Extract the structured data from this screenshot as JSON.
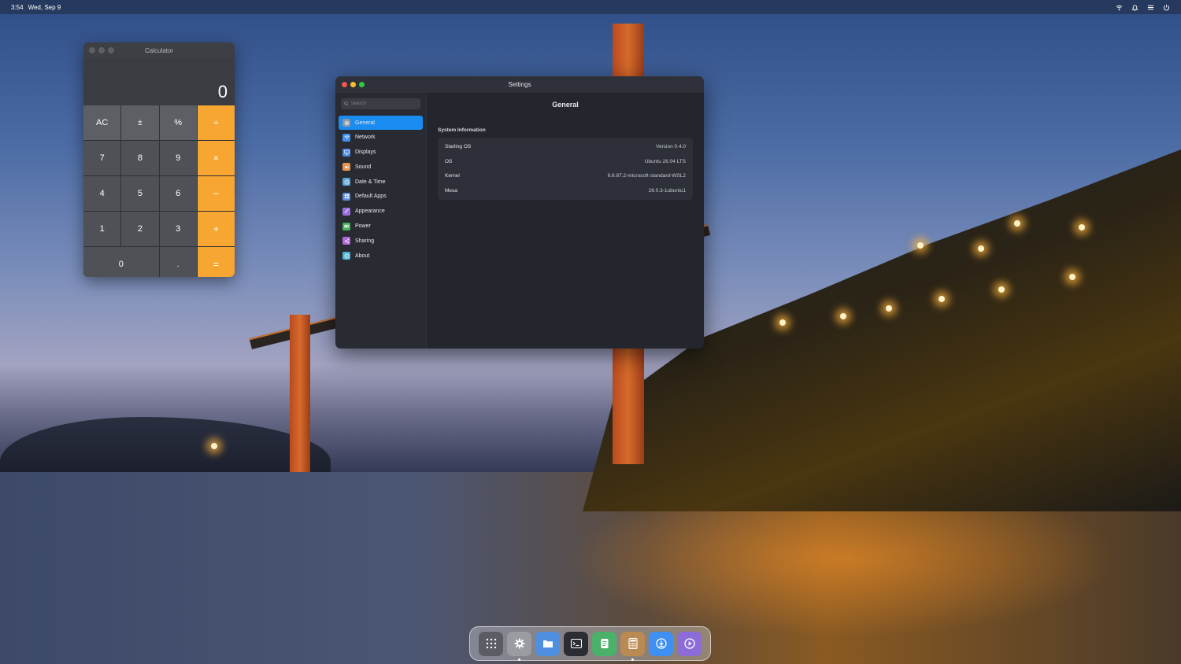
{
  "topbar": {
    "time": "3:54",
    "date": "Wed, Sep 9",
    "tray_icons": [
      "wifi-icon",
      "bell-icon",
      "menu-icon",
      "power-icon"
    ]
  },
  "calculator": {
    "title": "Calculator",
    "display": "0",
    "keys": [
      "AC",
      "±",
      "%",
      "÷",
      "7",
      "8",
      "9",
      "×",
      "4",
      "5",
      "6",
      "−",
      "1",
      "2",
      "3",
      "+",
      "0",
      ".",
      "="
    ],
    "colors": {
      "operator": "#f8a632",
      "function": "#5d5f64",
      "digit": "#4f5156"
    }
  },
  "settings": {
    "title": "Settings",
    "search_placeholder": "Search",
    "nav": [
      {
        "label": "General",
        "icon": "gear-icon",
        "color": "#8e95a3",
        "active": true
      },
      {
        "label": "Network",
        "icon": "wifi-icon",
        "color": "#3f8ef1"
      },
      {
        "label": "Displays",
        "icon": "display-icon",
        "color": "#4a87e5"
      },
      {
        "label": "Sound",
        "icon": "speaker-icon",
        "color": "#e8924a"
      },
      {
        "label": "Date & Time",
        "icon": "clock-icon",
        "color": "#5ba3d8"
      },
      {
        "label": "Default Apps",
        "icon": "grid-icon",
        "color": "#5d8be0"
      },
      {
        "label": "Appearance",
        "icon": "brush-icon",
        "color": "#9a6ee0"
      },
      {
        "label": "Power",
        "icon": "battery-icon",
        "color": "#45b35a"
      },
      {
        "label": "Sharing",
        "icon": "share-icon",
        "color": "#b069d9"
      },
      {
        "label": "About",
        "icon": "info-icon",
        "color": "#4cb4d4"
      }
    ],
    "page_title": "General",
    "section_label": "System Information",
    "info": [
      {
        "key": "Starling OS",
        "value": "Version 0.4.0"
      },
      {
        "key": "OS",
        "value": "Ubuntu 26.04 LTS"
      },
      {
        "key": "Kernel",
        "value": "6.6.87.2-microsoft-standard-WSL2"
      },
      {
        "key": "Mesa",
        "value": "26.0.3-1ubuntu1"
      }
    ],
    "accent": "#1a8cf2"
  },
  "dock": {
    "items": [
      {
        "name": "app-grid-icon",
        "color": "#5a5d64",
        "running": false
      },
      {
        "name": "settings-icon",
        "color": "#9a9ca2",
        "running": true
      },
      {
        "name": "files-icon",
        "color": "#4f8fe0",
        "running": false
      },
      {
        "name": "terminal-icon",
        "color": "#2b2d33",
        "running": false
      },
      {
        "name": "notes-icon",
        "color": "#4bb06a",
        "running": false
      },
      {
        "name": "calculator-icon",
        "color": "#b98a52",
        "running": true
      },
      {
        "name": "software-icon",
        "color": "#3f8ef1",
        "running": false
      },
      {
        "name": "media-player-icon",
        "color": "#8b6cd8",
        "running": false
      }
    ]
  }
}
